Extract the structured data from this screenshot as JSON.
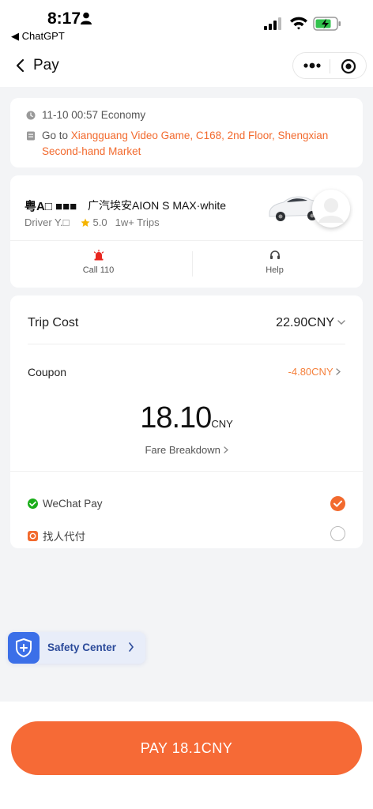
{
  "status_bar": {
    "time": "8:17",
    "back_app": "◀ ChatGPT"
  },
  "navbar": {
    "title": "Pay"
  },
  "trip": {
    "datetime": "11-10 00:57 Economy",
    "destination_prefix": "Go to ",
    "destination": "Xiangguang Video Game, C168, 2nd Floor, Shengxian Second-hand Market"
  },
  "driver": {
    "plate": "粤A□ ■■■",
    "car": "广汽埃安AION S MAX·white",
    "name": "Driver Y.□",
    "rating": "5.0",
    "trips": "1w+ Trips",
    "actions": [
      {
        "label": "Call 110",
        "icon": "alarm-icon"
      },
      {
        "label": "Help",
        "icon": "headset-icon"
      }
    ]
  },
  "payment": {
    "trip_cost_label": "Trip Cost",
    "trip_cost_value": "22.90CNY",
    "coupon_label": "Coupon",
    "coupon_value": "-4.80CNY",
    "total": "18.10",
    "currency": "CNY",
    "breakdown": "Fare Breakdown",
    "methods": [
      {
        "label": "WeChat Pay",
        "icon": "wechat-pay-icon",
        "selected": true
      },
      {
        "label": "找人代付",
        "icon": "proxy-pay-icon",
        "selected": false
      }
    ]
  },
  "safety": {
    "label": "Safety Center"
  },
  "pay_button": "PAY 18.1CNY",
  "colors": {
    "accent": "#f66a36",
    "destination": "#f26a2e",
    "coupon": "#f5813d",
    "safety_blue": "#3b6fe8"
  }
}
